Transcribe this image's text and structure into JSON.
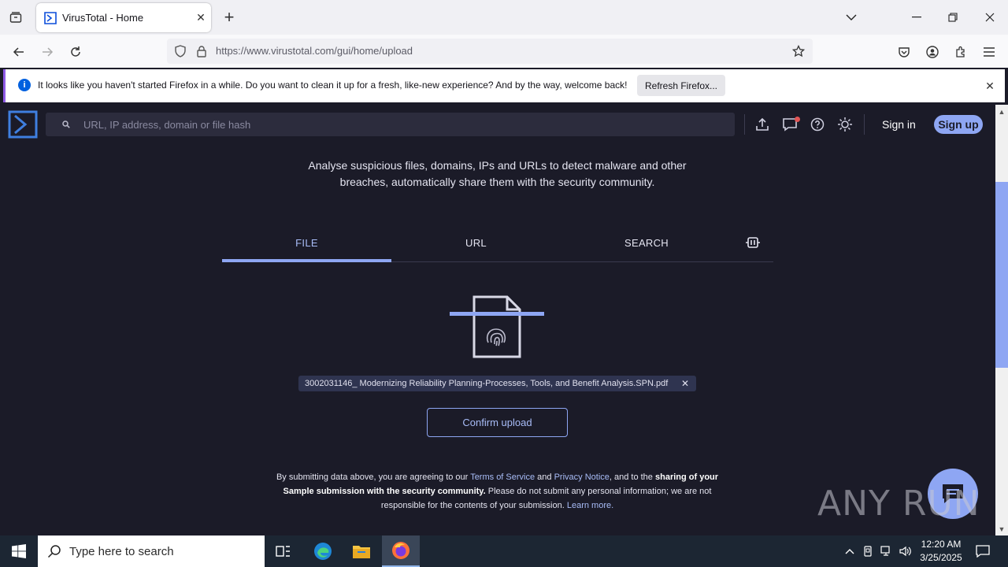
{
  "browser": {
    "tab_title": "VirusTotal - Home",
    "url_domain": "https://www.virustotal.com",
    "url_path": "/gui/home/upload"
  },
  "notification": {
    "message": "It looks like you haven't started Firefox in a while. Do you want to clean it up for a fresh, like-new experience? And by the way, welcome back!",
    "button": "Refresh Firefox..."
  },
  "header": {
    "search_placeholder": "URL, IP address, domain or file hash",
    "sign_in": "Sign in",
    "sign_up": "Sign up"
  },
  "main": {
    "tagline_line1": "Analyse suspicious files, domains, IPs and URLs to detect malware and other",
    "tagline_line2": "breaches, automatically share them with the security community.",
    "tabs": [
      {
        "label": "FILE",
        "active": true
      },
      {
        "label": "URL",
        "active": false
      },
      {
        "label": "SEARCH",
        "active": false
      }
    ],
    "selected_file": "3002031146_ Modernizing Reliability Planning-Processes, Tools, and Benefit Analysis.SPN.pdf",
    "confirm_button": "Confirm upload"
  },
  "legal": {
    "t1": "By submitting data above, you are agreeing to our ",
    "terms": "Terms of Service",
    "t2": " and ",
    "privacy": "Privacy Notice",
    "t3": ", and to the ",
    "bold": "sharing of your Sample submission with the security community.",
    "t4": " Please do not submit any personal information; we are not responsible for the contents of your submission. ",
    "learn": "Learn more."
  },
  "watermark": "ANY RUN",
  "taskbar": {
    "search_placeholder": "Type here to search",
    "time": "12:20 AM",
    "date": "3/25/2025"
  },
  "colors": {
    "accent": "#8ea6f3",
    "page_bg": "#1b1b28",
    "search_bg": "#2c2c3d"
  }
}
